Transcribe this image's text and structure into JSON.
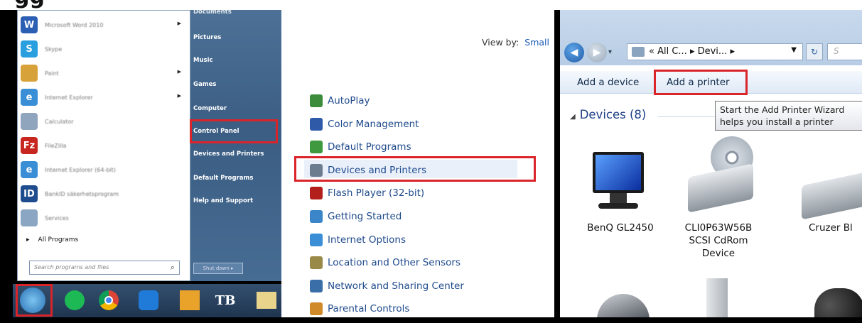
{
  "start_menu": {
    "programs": [
      {
        "label": "Microsoft Word 2010",
        "icon": "word-icon",
        "has_arrow": true,
        "color": "#2b5fb4",
        "glyph": "W"
      },
      {
        "label": "Skype",
        "icon": "skype-icon",
        "has_arrow": false,
        "color": "#2a9fe0",
        "glyph": "S"
      },
      {
        "label": "Paint",
        "icon": "paint-icon",
        "has_arrow": true,
        "color": "#d8a23a",
        "glyph": ""
      },
      {
        "label": "Internet Explorer",
        "icon": "internet-explorer-icon",
        "has_arrow": true,
        "color": "#3a8ed6",
        "glyph": "e"
      },
      {
        "label": "Calculator",
        "icon": "calculator-icon",
        "has_arrow": false,
        "color": "#8fa4bd",
        "glyph": ""
      },
      {
        "label": "FileZilla",
        "icon": "filezilla-icon",
        "has_arrow": false,
        "color": "#c7261e",
        "glyph": "Fz"
      },
      {
        "label": "Internet Explorer (64-bit)",
        "icon": "internet-explorer-64-icon",
        "has_arrow": false,
        "color": "#3a8ed6",
        "glyph": "e"
      },
      {
        "label": "BankID säkerhetsprogram",
        "icon": "bankid-icon",
        "has_arrow": false,
        "color": "#1f4c8f",
        "glyph": "ID"
      },
      {
        "label": "Services",
        "icon": "services-icon",
        "has_arrow": false,
        "color": "#8aa6c2",
        "glyph": ""
      }
    ],
    "all_programs": "All Programs",
    "search_placeholder": "Search programs and files",
    "right_items": [
      "Documents",
      "Pictures",
      "Music",
      "Games",
      "Computer",
      "Control Panel",
      "Devices and Printers",
      "Default Programs",
      "Help and Support"
    ],
    "shutdown": "Shut down"
  },
  "taskbar": {
    "apps": [
      "start-orb-icon",
      "spotify-icon",
      "chrome-icon",
      "teamviewer-icon",
      "outlook-icon",
      "tb-icon",
      "file-explorer-icon"
    ],
    "tb_label": "TB"
  },
  "control_panel": {
    "view_by_label": "View by:",
    "view_by_value": "Small",
    "items": [
      {
        "label": "AutoPlay",
        "icon": "autoplay-icon",
        "color": "#3c8c3c"
      },
      {
        "label": "Color Management",
        "icon": "color-management-icon",
        "color": "#2e5aa8"
      },
      {
        "label": "Default Programs",
        "icon": "default-programs-icon",
        "color": "#3f9a3f"
      },
      {
        "label": "Devices and Printers",
        "icon": "devices-printers-icon",
        "color": "#6d7d90"
      },
      {
        "label": "Flash Player (32-bit)",
        "icon": "flash-player-icon",
        "color": "#b3201b"
      },
      {
        "label": "Getting Started",
        "icon": "getting-started-icon",
        "color": "#3a86c8"
      },
      {
        "label": "Internet Options",
        "icon": "internet-options-icon",
        "color": "#3a8ed6"
      },
      {
        "label": "Location and Other Sensors",
        "icon": "location-sensors-icon",
        "color": "#9a8a4a"
      },
      {
        "label": "Network and Sharing Center",
        "icon": "network-sharing-icon",
        "color": "#3a6ea8"
      },
      {
        "label": "Parental Controls",
        "icon": "parental-controls-icon",
        "color": "#d08a2a"
      }
    ]
  },
  "devices_window": {
    "address": "« All C... ▸ Devi... ▸",
    "search_placeholder": "S",
    "commands": {
      "add_device": "Add a device",
      "add_printer": "Add a printer"
    },
    "section_title": "Devices (8)",
    "tooltip_line1": "Start the Add Printer Wizard",
    "tooltip_line2": "helps you install a printer",
    "devices": [
      {
        "label": "BenQ GL2450",
        "icon": "monitor-icon"
      },
      {
        "label": "CLI0P63W56B SCSI CdRom Device",
        "icon": "cd-drive-icon"
      },
      {
        "label": "Cruzer Bl",
        "icon": "usb-drive-icon"
      }
    ]
  }
}
